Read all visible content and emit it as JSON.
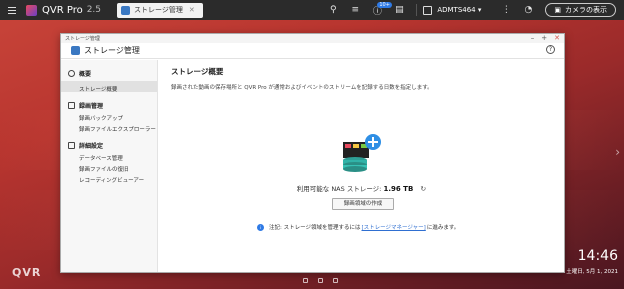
{
  "topbar": {
    "app_title": "QVR Pro",
    "app_version": "2.5",
    "tab_label": "ストレージ管理",
    "notification_count": "10+",
    "username": "ADMTS464 ▾",
    "camera_view_label": "カメラの表示"
  },
  "window": {
    "titlebar_text": "ストレージ管理",
    "header_title": "ストレージ管理",
    "help_label": "?"
  },
  "sidebar": {
    "sections": [
      {
        "label": "概要",
        "items": [
          "ストレージ概要"
        ]
      },
      {
        "label": "録画管理",
        "items": [
          "録画バックアップ",
          "録画ファイルエクスプローラー"
        ]
      },
      {
        "label": "詳細設定",
        "items": [
          "データベース管理",
          "録画ファイルの復旧",
          "レコーディングビューアー"
        ]
      }
    ],
    "active_item": "ストレージ概要"
  },
  "main": {
    "title": "ストレージ概要",
    "description": "録画された動画の保存場所と QVR Pro が通常およびイベントのストリームを記録する日数を指定します。",
    "storage_label": "利用可能な NAS ストレージ:",
    "storage_value": "1.96 TB",
    "create_button": "録画領域の作成",
    "note_prefix": "注記: ストレージ領域を管理するには",
    "note_link": "[ストレージマネージャー]",
    "note_suffix": "に進みます。"
  },
  "desktop": {
    "logo_text": "QVR",
    "clock": "14:46",
    "date": "土曜日, 5月 1, 2021"
  },
  "colors": {
    "accent": "#2f7ae5",
    "topbar_bg": "#2b2b2b",
    "close_red": "#d9534f"
  }
}
